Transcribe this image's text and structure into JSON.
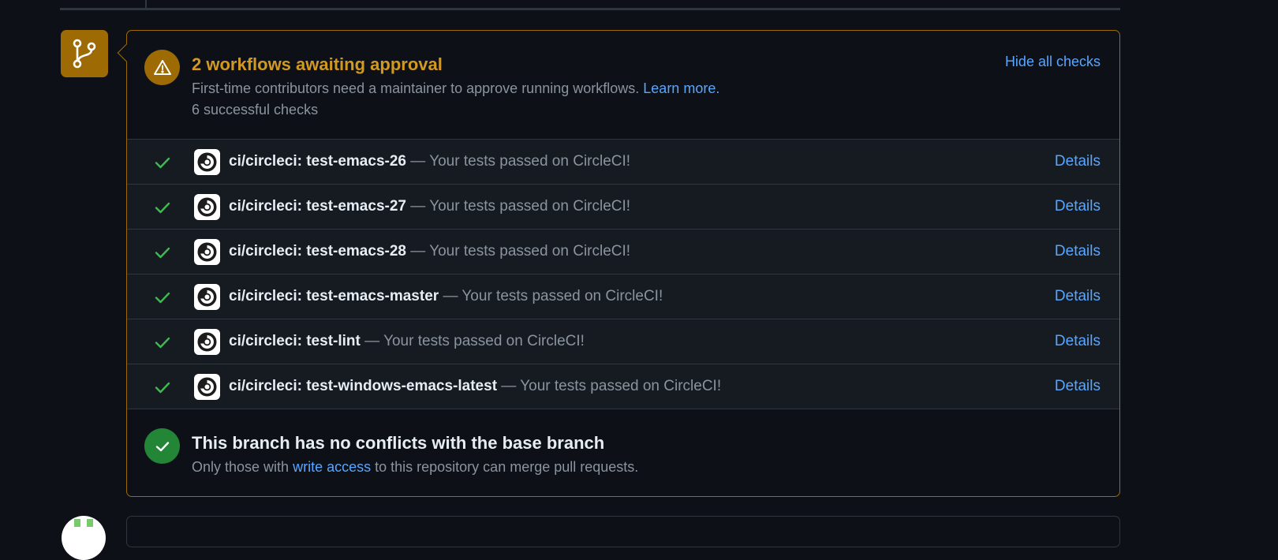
{
  "approval": {
    "title": "2 workflows awaiting approval",
    "description": "First-time contributors need a maintainer to approve running workflows.",
    "learn_more": "Learn more.",
    "count": "6 successful checks",
    "hide_checks": "Hide all checks"
  },
  "checks": [
    {
      "name": "ci/circleci: test-emacs-26",
      "separator": "—",
      "desc": "Your tests passed on CircleCI!",
      "details": "Details"
    },
    {
      "name": "ci/circleci: test-emacs-27",
      "separator": "—",
      "desc": "Your tests passed on CircleCI!",
      "details": "Details"
    },
    {
      "name": "ci/circleci: test-emacs-28",
      "separator": "—",
      "desc": "Your tests passed on CircleCI!",
      "details": "Details"
    },
    {
      "name": "ci/circleci: test-emacs-master",
      "separator": "—",
      "desc": "Your tests passed on CircleCI!",
      "details": "Details"
    },
    {
      "name": "ci/circleci: test-lint",
      "separator": "—",
      "desc": "Your tests passed on CircleCI!",
      "details": "Details"
    },
    {
      "name": "ci/circleci: test-windows-emacs-latest",
      "separator": "—",
      "desc": "Your tests passed on CircleCI!",
      "details": "Details"
    }
  ],
  "merge": {
    "title": "This branch has no conflicts with the base branch",
    "desc_before": "Only those with",
    "write_access": "write access",
    "desc_after": "to this repository can merge pull requests."
  },
  "icons": {
    "merge_box": "git-branch-icon",
    "warning": "alert-icon",
    "check": "check-icon",
    "ci_avatar": "circleci-icon",
    "ok": "check-circle-icon"
  },
  "colors": {
    "background": "#0d1117",
    "warning_accent": "#d29922",
    "warning_fill": "#9e6a03",
    "success": "#3fb950",
    "success_fill": "#238636",
    "link": "#58a6ff",
    "muted": "#8b949e"
  }
}
